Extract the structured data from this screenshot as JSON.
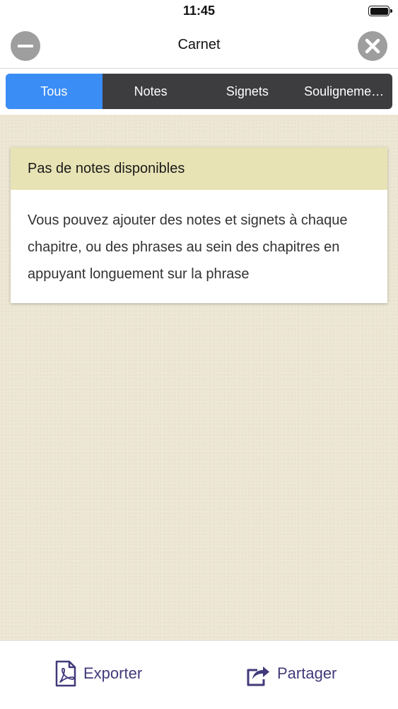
{
  "status_bar": {
    "time": "11:45"
  },
  "nav": {
    "title": "Carnet"
  },
  "tabs": [
    {
      "label": "Tous",
      "active": true
    },
    {
      "label": "Notes",
      "active": false
    },
    {
      "label": "Signets",
      "active": false
    },
    {
      "label": "Souligneme…",
      "active": false
    }
  ],
  "card": {
    "title": "Pas de notes disponibles",
    "body": "Vous pouvez ajouter des notes et signets à chaque chapitre, ou des phrases au sein des chapitres en appuyant longuement sur la phrase"
  },
  "toolbar": {
    "export_label": "Exporter",
    "share_label": "Partager"
  },
  "colors": {
    "active_tab": "#3a8df5",
    "tab_bar": "#3d3d40",
    "card_header": "#e8e3b4",
    "background": "#ece6d3",
    "toolbar_accent": "#413a7a"
  },
  "icons": {
    "left_nav": "minus-circle-icon",
    "right_nav": "close-circle-icon",
    "export": "pdf-file-icon",
    "share": "share-arrow-icon"
  }
}
